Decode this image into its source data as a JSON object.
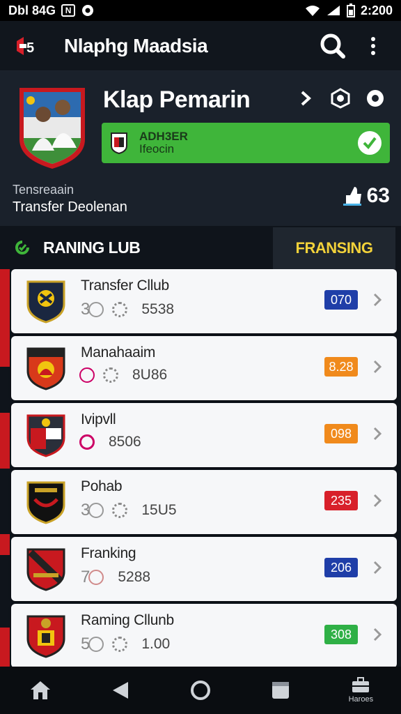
{
  "status": {
    "left_text": "Dbl 84G",
    "badge": "N",
    "time": "2:200"
  },
  "appbar": {
    "title": "Nlaphg Maadsia",
    "logo": "team-logo-icon"
  },
  "header": {
    "title": "Klap Pemarin",
    "green_line1": "ADH3ER",
    "green_line2": "Ifeocin",
    "sub1": "Tensreaain",
    "sub2": "Transfer Deolenan",
    "count": "63"
  },
  "tabs": {
    "left": "RANING LUB",
    "right": "FRANSING"
  },
  "rows": [
    {
      "name": "Transfer Cllub",
      "n1": "3",
      "n2": "5538",
      "badge": "070",
      "color": "#1f3ea8"
    },
    {
      "name": "Manahaaim",
      "n1": "",
      "n2": "8U86",
      "badge": "8.28",
      "color": "#f08a1c"
    },
    {
      "name": "Ivipvll",
      "n1": "",
      "n2": "8506",
      "badge": "098",
      "color": "#f08a1c"
    },
    {
      "name": "Pohab",
      "n1": "3",
      "n2": "15U5",
      "badge": "235",
      "color": "#d8202a"
    },
    {
      "name": "Franking",
      "n1": "7",
      "n2": "5288",
      "badge": "206",
      "color": "#1f3ea8"
    },
    {
      "name": "Raming Cllunb",
      "n1": "5",
      "n2": "1.00",
      "badge": "308",
      "color": "#2fb046"
    }
  ],
  "nav": {
    "last_label": "Haroes"
  }
}
